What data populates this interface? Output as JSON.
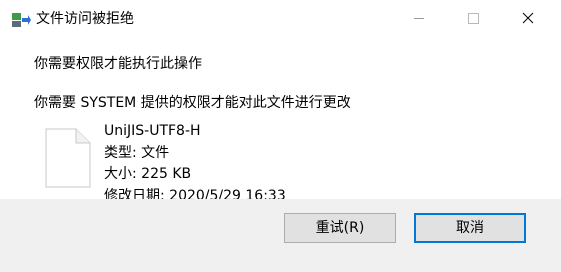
{
  "window": {
    "title": "文件访问被拒绝",
    "icon": "file-transfer-icon",
    "controls": [
      "minimize-icon",
      "maximize-icon",
      "close-icon"
    ]
  },
  "message": {
    "headline": "你需要权限才能执行此操作",
    "detail": "你需要 SYSTEM 提供的权限才能对此文件进行更改"
  },
  "file": {
    "icon": "file-icon",
    "name": "UniJIS-UTF8-H",
    "type": "类型: 文件",
    "size": "大小: 225 KB",
    "modified": "修改日期: 2020/5/29 16:33"
  },
  "buttons": {
    "retry": "重试(R)",
    "cancel": "取消"
  },
  "colors": {
    "footer": "#f0f0f0",
    "button_face": "#e1e1e1",
    "button_border": "#adadad",
    "focus_border": "#0078d7",
    "icon_green": "#3f9b4a",
    "icon_blue": "#2f6fd0"
  }
}
